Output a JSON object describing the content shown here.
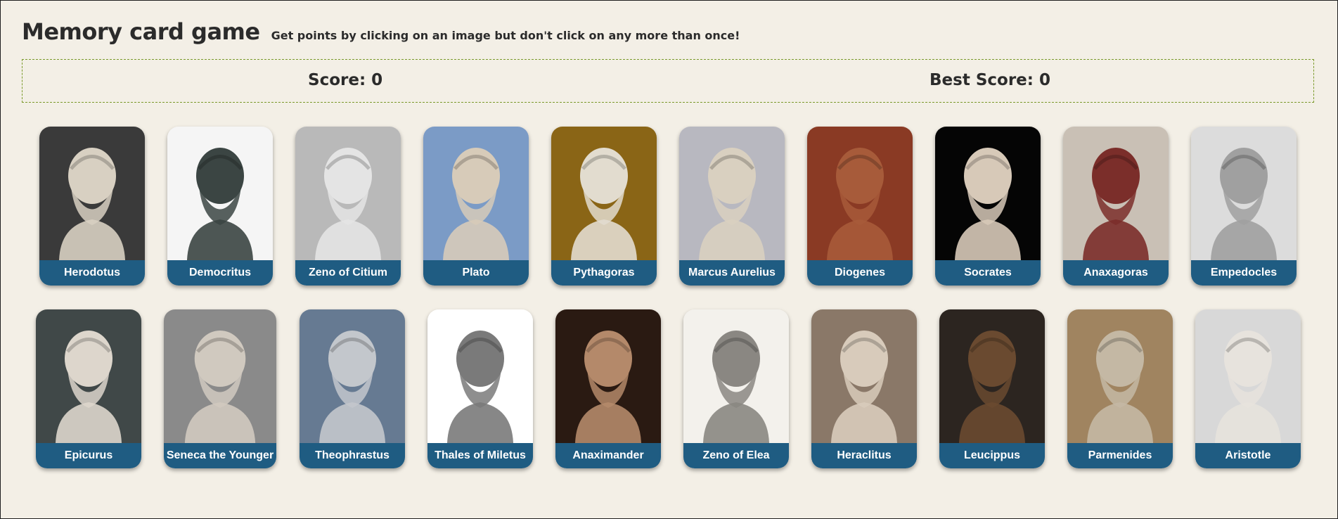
{
  "header": {
    "title": "Memory card game",
    "subtitle": "Get points by clicking on an image but don't click on any more than once!"
  },
  "scoreboard": {
    "score_text": "Score: 0",
    "best_text": "Best Score: 0"
  },
  "cards": [
    {
      "name": "Herodotus",
      "bg": "#3a3a3a",
      "bust": "#d8d0c2"
    },
    {
      "name": "Democritus",
      "bg": "#f5f5f5",
      "bust": "#3b4543"
    },
    {
      "name": "Zeno of Citium",
      "bg": "#b9b9b9",
      "bust": "#e4e4e4"
    },
    {
      "name": "Plato",
      "bg": "#7b9bc6",
      "bust": "#d7cbb9"
    },
    {
      "name": "Pythagoras",
      "bg": "#8a6516",
      "bust": "#e2dccf"
    },
    {
      "name": "Marcus Aurelius",
      "bg": "#b8b8c0",
      "bust": "#d9d0c0"
    },
    {
      "name": "Diogenes",
      "bg": "#8a3a24",
      "bust": "#a75b3a"
    },
    {
      "name": "Socrates",
      "bg": "#050505",
      "bust": "#d7c9b8"
    },
    {
      "name": "Anaxagoras",
      "bg": "#c9c0b5",
      "bust": "#7b2e2a"
    },
    {
      "name": "Empedocles",
      "bg": "#dcdcdc",
      "bust": "#a0a0a0"
    },
    {
      "name": "Epicurus",
      "bg": "#404848",
      "bust": "#ddd6cc"
    },
    {
      "name": "Seneca the Younger",
      "bg": "#8a8a8a",
      "bust": "#d0c9bf"
    },
    {
      "name": "Theophrastus",
      "bg": "#667a92",
      "bust": "#c3c7cc"
    },
    {
      "name": "Thales of Miletus",
      "bg": "#ffffff",
      "bust": "#7a7a7a"
    },
    {
      "name": "Anaximander",
      "bg": "#2a1a12",
      "bust": "#b4896a"
    },
    {
      "name": "Zeno of Elea",
      "bg": "#f3f1ec",
      "bust": "#8a8782"
    },
    {
      "name": "Heraclitus",
      "bg": "#8a7868",
      "bust": "#d8cbbb"
    },
    {
      "name": "Leucippus",
      "bg": "#2c2520",
      "bust": "#6a4a30"
    },
    {
      "name": "Parmenides",
      "bg": "#a08460",
      "bust": "#c4b8a4"
    },
    {
      "name": "Aristotle",
      "bg": "#d8d8d8",
      "bust": "#e7e3dd"
    }
  ]
}
